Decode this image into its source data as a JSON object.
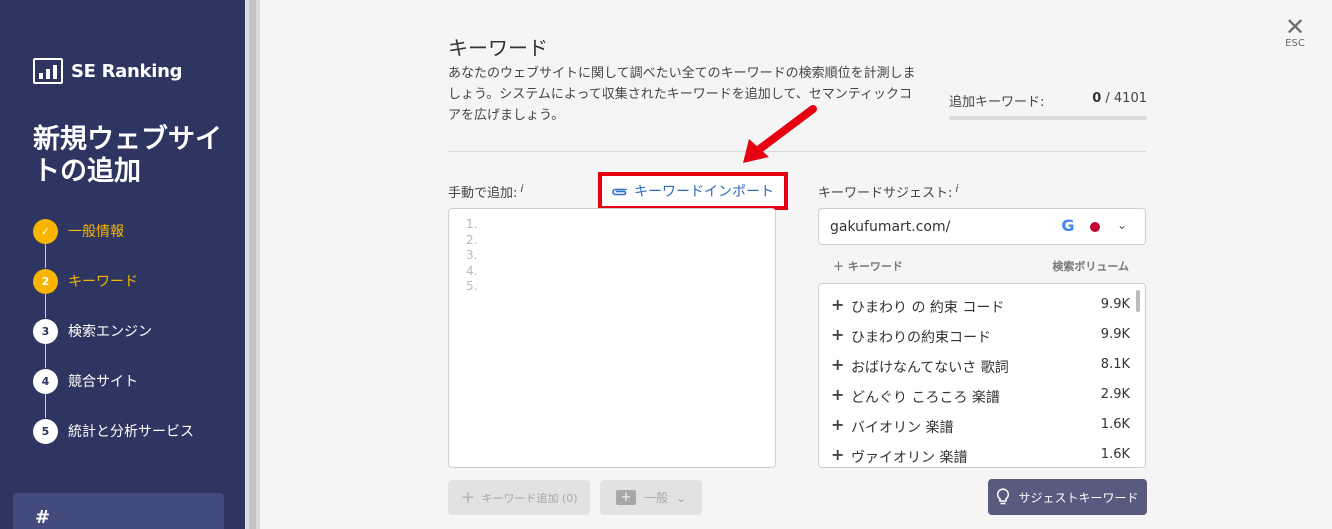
{
  "sidebar": {
    "logo_text": "SE Ranking",
    "title": "新規ウェブサイトの追加",
    "steps": [
      {
        "num": "✓",
        "label": "一般情報",
        "state": "done"
      },
      {
        "num": "2",
        "label": "キーワード",
        "state": "active"
      },
      {
        "num": "3",
        "label": "検索エンジン",
        "state": "pending"
      },
      {
        "num": "4",
        "label": "競合サイト",
        "state": "pending"
      },
      {
        "num": "5",
        "label": "統計と分析サービス",
        "state": "pending"
      }
    ],
    "bottom_button": "#"
  },
  "close": {
    "symbol": "✕",
    "label": "ESC"
  },
  "main": {
    "title": "キーワード",
    "description": "あなたのウェブサイトに関して調べたい全てのキーワードの検索順位を計測しましょう。システムによって収集されたキーワードを追加して、セマンティックコアを広げましょう。",
    "count_label": "追加キーワード:",
    "count_value": "0",
    "count_total": " / 4101"
  },
  "manual": {
    "label": "手動で追加:",
    "info": "i",
    "import_label": "キーワードインポート",
    "line_numbers": [
      "1.",
      "2.",
      "3.",
      "4.",
      "5."
    ],
    "add_button": "キーワード追加 (0)",
    "group_button": "一般"
  },
  "suggest": {
    "label": "キーワードサジェスト:",
    "info": "i",
    "domain": "gakufumart.com/",
    "search_engine_letter": "G",
    "header_keyword": "キーワード",
    "header_volume": "検索ボリューム",
    "rows": [
      {
        "keyword": "ひまわり の 約束 コード",
        "volume": "9.9K"
      },
      {
        "keyword": "ひまわりの約束コード",
        "volume": "9.9K"
      },
      {
        "keyword": "おばけなんてないさ 歌詞",
        "volume": "8.1K"
      },
      {
        "keyword": "どんぐり ころころ 楽譜",
        "volume": "2.9K"
      },
      {
        "keyword": "バイオリン 楽譜",
        "volume": "1.6K"
      },
      {
        "keyword": "ヴァイオリン 楽譜",
        "volume": "1.6K"
      }
    ],
    "button": "サジェストキーワード"
  },
  "colors": {
    "sidebar": "#2f3561",
    "accent": "#f7b500",
    "highlight": "#e60012",
    "link": "#2d6cc0"
  }
}
